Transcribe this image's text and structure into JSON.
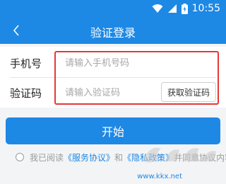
{
  "status_bar": {
    "time": "10:55",
    "icons": [
      "wifi-icon",
      "signal-icon",
      "battery-icon"
    ]
  },
  "app_bar": {
    "back_icon": "chevron-left-icon",
    "title": "验证登录"
  },
  "form": {
    "phone": {
      "label": "手机号",
      "placeholder": "请输入手机号码",
      "value": ""
    },
    "code": {
      "label": "验证码",
      "placeholder": "请输入验证码",
      "value": "",
      "button_label": "获取验证码"
    }
  },
  "start_button": {
    "label": "开始"
  },
  "agreement": {
    "prefix": "我已阅读",
    "service_link": "《服务协议》",
    "conjunction": "和",
    "privacy_link": "《隐私政策》",
    "suffix": "并同意协议内容",
    "checked": false
  },
  "watermark": {
    "text": "www.kkx.net"
  },
  "colors": {
    "primary": "#1e88e5",
    "highlight": "#e53935",
    "background": "#f3f4f6"
  }
}
